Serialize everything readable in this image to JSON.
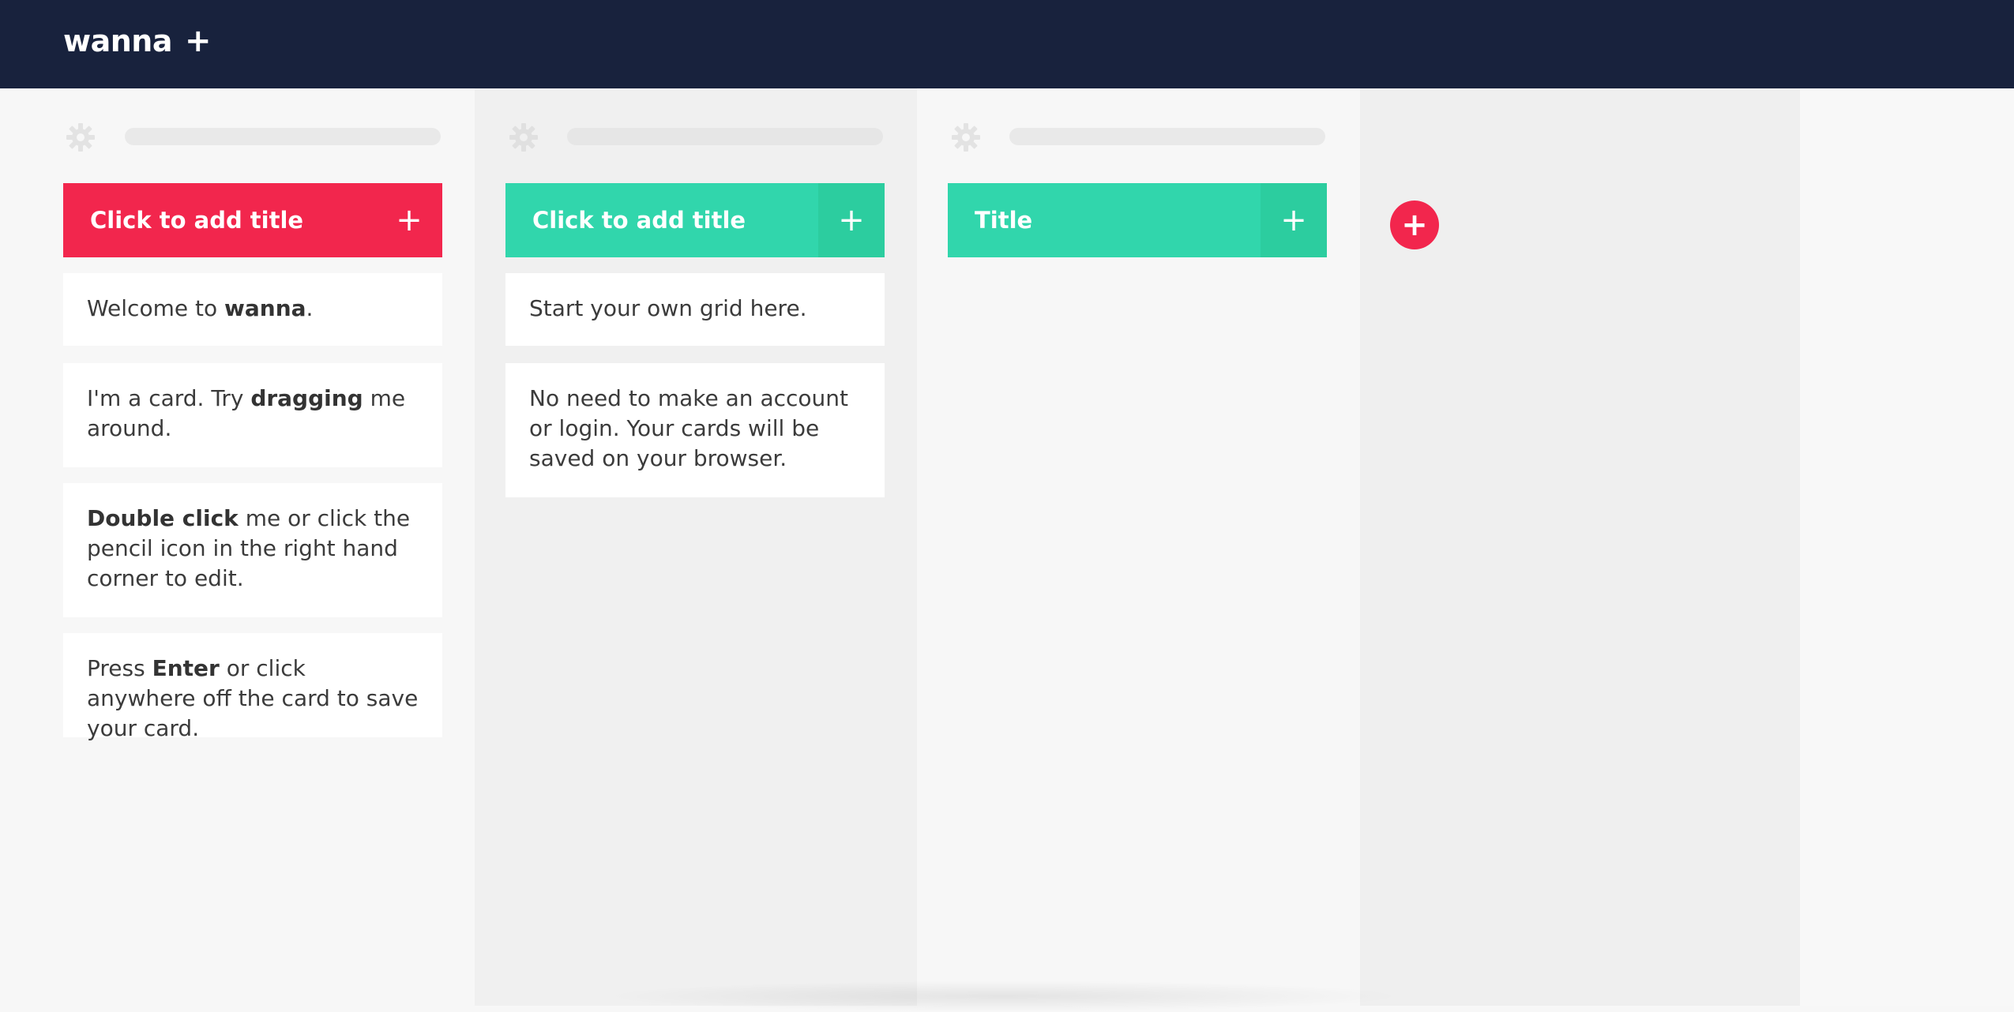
{
  "app": {
    "logo_text": "wanna",
    "logo_plus": "+"
  },
  "columns": [
    {
      "title": "Click to add title",
      "header_color": "#f2264d",
      "add_label": "+",
      "cards": [
        {
          "parts": [
            "Welcome to ",
            "wanna",
            "."
          ]
        },
        {
          "parts": [
            "I'm a card. Try ",
            "dragging",
            " me around."
          ]
        },
        {
          "parts": [
            "Double click",
            " me or click the pencil icon in the right hand corner to edit."
          ]
        },
        {
          "parts": [
            "Press ",
            "Enter",
            " or click anywhere off the card to save your card."
          ]
        }
      ]
    },
    {
      "title": "Click to add title",
      "header_color": "#31d6ac",
      "add_label": "+",
      "cards": [
        {
          "text": "Start your own grid here."
        },
        {
          "text": "No need to make an account or login. Your cards will be saved on your browser."
        }
      ]
    },
    {
      "title": "Title",
      "header_color": "#31d6ac",
      "add_label": "+",
      "cards": []
    }
  ],
  "add_column_label": "+",
  "icons": {
    "settings": "gear-icon",
    "add": "plus-icon"
  },
  "colors": {
    "topbar": "#18223d",
    "accent_red": "#f2264d",
    "accent_green": "#31d6ac"
  }
}
